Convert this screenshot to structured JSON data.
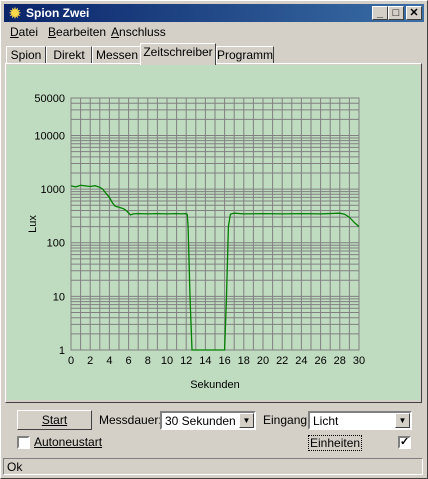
{
  "window": {
    "title": "Spion Zwei",
    "minimize_glyph": "_",
    "maximize_glyph": "□",
    "close_glyph": "✕"
  },
  "menu": {
    "items": [
      {
        "label": "Datei",
        "access_key": "D"
      },
      {
        "label": "Bearbeiten",
        "access_key": "B"
      },
      {
        "label": "Anschluss",
        "access_key": "A"
      }
    ]
  },
  "tabs": [
    {
      "label": "Spion"
    },
    {
      "label": "Direkt"
    },
    {
      "label": "Messen"
    },
    {
      "label": "Zeitschreiber",
      "active": true
    },
    {
      "label": "Programm"
    }
  ],
  "controls": {
    "start_label": "Start",
    "messdauer_label": "Messdauer:",
    "messdauer_value": "30 Sekunden",
    "eingang_label": "Eingang:",
    "eingang_value": "Licht",
    "autoneustart_label": "Autoneustart",
    "autoneustart_checked": false,
    "einheiten_label": "Einheiten",
    "einheiten_checked": true
  },
  "status": {
    "text": "Ok"
  },
  "colors": {
    "chart_bg": "#c0dcc0",
    "series": "#008000",
    "grid": "#808080",
    "titlebar": "#0a246a"
  },
  "chart_data": {
    "type": "line",
    "xlabel": "Sekunden",
    "ylabel": "Lux",
    "xlim": [
      0,
      30
    ],
    "ylim": [
      1,
      50000
    ],
    "yscale": "log",
    "grid": true,
    "x_ticks": [
      "0",
      "2",
      "4",
      "6",
      "8",
      "10",
      "12",
      "14",
      "16",
      "18",
      "20",
      "22",
      "24",
      "26",
      "28",
      "30"
    ],
    "y_ticks": [
      {
        "value": 1,
        "label": "1"
      },
      {
        "value": 10,
        "label": "10"
      },
      {
        "value": 100,
        "label": "100"
      },
      {
        "value": 1000,
        "label": "1000"
      },
      {
        "value": 10000,
        "label": "10000"
      },
      {
        "value": 50000,
        "label": "50000"
      }
    ],
    "series": [
      {
        "x": [
          0,
          0.5,
          1,
          1.5,
          2,
          2.5,
          3,
          3.3,
          3.6,
          4,
          4.3,
          4.6,
          5,
          5.5,
          5.8,
          6,
          6.2,
          6.5,
          7,
          8,
          9,
          10,
          11,
          11.5,
          11.9,
          12.1,
          12.2,
          12.4,
          12.6,
          13,
          14,
          15,
          16,
          16.2,
          16.4,
          16.6,
          16.8,
          17,
          18,
          20,
          22,
          24,
          26,
          28,
          28.5,
          29,
          29.5,
          30
        ],
        "y": [
          1150,
          1100,
          1180,
          1150,
          1120,
          1160,
          1080,
          1000,
          850,
          700,
          560,
          480,
          460,
          430,
          390,
          360,
          330,
          345,
          350,
          345,
          350,
          345,
          350,
          345,
          350,
          340,
          200,
          10,
          1,
          1,
          1,
          1,
          1,
          10,
          200,
          340,
          350,
          355,
          345,
          350,
          345,
          350,
          345,
          355,
          340,
          300,
          240,
          200
        ]
      }
    ]
  }
}
